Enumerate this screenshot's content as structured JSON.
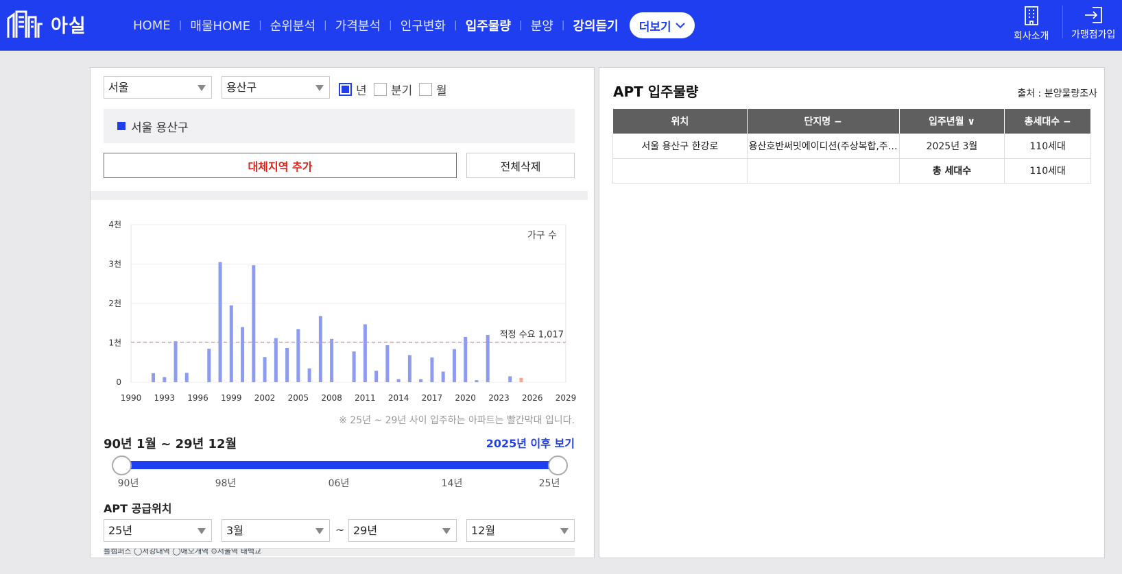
{
  "header": {
    "logo_text": "아실",
    "nav": [
      "HOME",
      "매물HOME",
      "순위분석",
      "가격분석",
      "인구변화",
      "입주물량",
      "분양",
      "강의듣기"
    ],
    "active_nav": "입주물량",
    "more_label": "더보기",
    "company_label": "회사소개",
    "franchise_label": "가맹점가입"
  },
  "filters": {
    "city": "서울",
    "district": "용산구",
    "period_options": [
      {
        "label": "년",
        "checked": true
      },
      {
        "label": "분기",
        "checked": false
      },
      {
        "label": "월",
        "checked": false
      }
    ],
    "selected_region": "서울 용산구",
    "add_region_label": "대체지역 추가",
    "delete_all_label": "전체삭제"
  },
  "chart_data": {
    "type": "bar",
    "ylabel": "가구 수",
    "y_ticks": [
      "0",
      "1천",
      "2천",
      "3천",
      "4천"
    ],
    "ylim": [
      0,
      4000
    ],
    "x_ticks": [
      "1990",
      "1993",
      "1996",
      "1999",
      "2002",
      "2005",
      "2008",
      "2011",
      "2014",
      "2017",
      "2020",
      "2023",
      "2026",
      "2029"
    ],
    "x_range": [
      1990,
      2029
    ],
    "reference_line": {
      "label": "적정 수요 1,017",
      "value": 1017
    },
    "bars": [
      {
        "year": 1992,
        "value": 230,
        "future": false
      },
      {
        "year": 1993,
        "value": 130,
        "future": false
      },
      {
        "year": 1994,
        "value": 1040,
        "future": false
      },
      {
        "year": 1995,
        "value": 240,
        "future": false
      },
      {
        "year": 1997,
        "value": 850,
        "future": false
      },
      {
        "year": 1998,
        "value": 3050,
        "future": false
      },
      {
        "year": 1999,
        "value": 1950,
        "future": false
      },
      {
        "year": 2000,
        "value": 1400,
        "future": false
      },
      {
        "year": 2001,
        "value": 2970,
        "future": false
      },
      {
        "year": 2002,
        "value": 640,
        "future": false
      },
      {
        "year": 2003,
        "value": 1120,
        "future": false
      },
      {
        "year": 2004,
        "value": 870,
        "future": false
      },
      {
        "year": 2005,
        "value": 1350,
        "future": false
      },
      {
        "year": 2006,
        "value": 350,
        "future": false
      },
      {
        "year": 2007,
        "value": 1680,
        "future": false
      },
      {
        "year": 2008,
        "value": 1100,
        "future": false
      },
      {
        "year": 2010,
        "value": 780,
        "future": false
      },
      {
        "year": 2011,
        "value": 1470,
        "future": false
      },
      {
        "year": 2012,
        "value": 290,
        "future": false
      },
      {
        "year": 2013,
        "value": 940,
        "future": false
      },
      {
        "year": 2014,
        "value": 80,
        "future": false
      },
      {
        "year": 2015,
        "value": 690,
        "future": false
      },
      {
        "year": 2016,
        "value": 80,
        "future": false
      },
      {
        "year": 2017,
        "value": 630,
        "future": false
      },
      {
        "year": 2018,
        "value": 270,
        "future": false
      },
      {
        "year": 2019,
        "value": 840,
        "future": false
      },
      {
        "year": 2020,
        "value": 1150,
        "future": false
      },
      {
        "year": 2021,
        "value": 50,
        "future": false
      },
      {
        "year": 2022,
        "value": 1200,
        "future": false
      },
      {
        "year": 2024,
        "value": 150,
        "future": false
      },
      {
        "year": 2025,
        "value": 110,
        "future": true
      }
    ],
    "colors": {
      "bar": "#8d9cf0",
      "future_bar": "#f5a98c",
      "reference": "#f08a8a"
    }
  },
  "chart_note": "※ 25년 ~ 29년 사이 입주하는 아파트는 빨간막대 입니다.",
  "range": {
    "label": "90년 1월 ~ 29년 12월",
    "link": "2025년 이후 보기",
    "slider_ticks": [
      "90년",
      "98년",
      "06년",
      "14년",
      "25년"
    ],
    "min": 1990,
    "max": 2025,
    "low": 1990,
    "high": 2025
  },
  "supply_location": {
    "title": "APT 공급위치",
    "from_year": "25년",
    "from_month": "3월",
    "to_year": "29년",
    "to_month": "12월",
    "tilde": "~",
    "map_fragment": "를캠퍼스   ◯서강대역         ◯애오개역          ⊙서울역           태백교"
  },
  "right_panel": {
    "title": "APT 입주물량",
    "source": "출처 : 분양물량조사",
    "columns": [
      "위치",
      "단지명 −",
      "입주년월 ∨",
      "총세대수 −"
    ],
    "rows": [
      [
        "서울 용산구 한강로",
        "용산호반써밋에이디션(주상복합,주…",
        "2025년 3월",
        "110세대"
      ],
      [
        "",
        "",
        "총 세대수",
        "110세대"
      ]
    ]
  }
}
